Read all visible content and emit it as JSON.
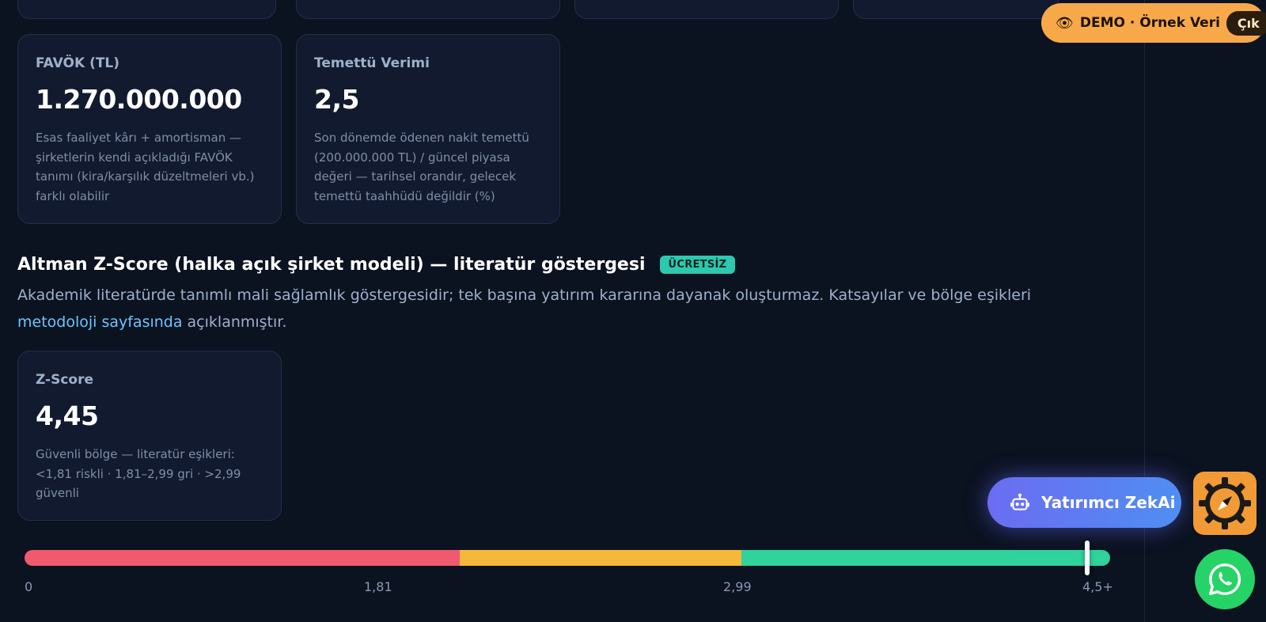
{
  "cards": {
    "favok": {
      "title": "FAVÖK (TL)",
      "value": "1.270.000.000",
      "description": "Esas faaliyet kârı + amortisman — şirketlerin kendi açıkladığı FAVÖK tanımı (kira/karşılık düzeltmeleri vb.) farklı olabilir"
    },
    "dividend": {
      "title": "Temettü Verimi",
      "value": "2,5",
      "description": "Son dönemde ödenen nakit temettü (200.000.000 TL) / güncel piyasa değeri — tarihsel orandır, gelecek temettü taahhüdü değildir (%)"
    },
    "zscore": {
      "title": "Z-Score",
      "value": "4,45",
      "description": "Güvenli bölge — literatür eşikleri: <1,81 riskli · 1,81–2,99 gri · >2,99 güvenli"
    }
  },
  "section": {
    "title": "Altman Z-Score (halka açık şirket modeli) — literatür göstergesi",
    "badge": "ÜCRETSİZ",
    "description_prefix": "Akademik literatürde tanımlı mali sağlamlık göstergesidir; tek başına yatırım kararına dayanak oluşturmaz. Katsayılar ve bölge eşikleri ",
    "link_text": "metodoloji sayfasında",
    "description_suffix": " açıklanmıştır."
  },
  "scale": {
    "ticks": [
      "0",
      "1,81",
      "2,99",
      "4,5+"
    ],
    "marker_value": 4.45,
    "colors": {
      "risky": "#f05a6e",
      "grey": "#f5b839",
      "safe": "#2fd39b"
    }
  },
  "demo": {
    "icon": "eye-icon",
    "label": "DEMO · Örnek Veri",
    "exit_label": "Çık"
  },
  "assistant": {
    "icon": "robot-icon",
    "label": "Yatırımcı ZekAi"
  },
  "floating": {
    "compass_icon": "compass-gear-icon",
    "whatsapp_icon": "whatsapp-icon"
  }
}
